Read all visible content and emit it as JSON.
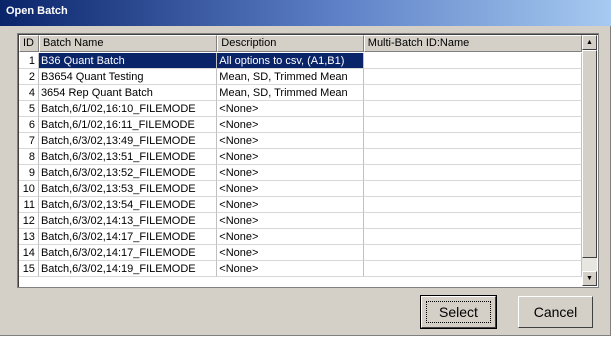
{
  "window": {
    "title": "Open Batch"
  },
  "columns": [
    "ID",
    "Batch Name",
    "Description",
    "Multi-Batch ID:Name"
  ],
  "rows": [
    {
      "id": "1",
      "name": "B36 Quant Batch",
      "description": "All options to csv, (A1,B1)",
      "multi": ""
    },
    {
      "id": "2",
      "name": "B3654 Quant Testing",
      "description": "Mean, SD, Trimmed Mean",
      "multi": ""
    },
    {
      "id": "4",
      "name": "3654 Rep Quant Batch",
      "description": "Mean, SD, Trimmed Mean",
      "multi": ""
    },
    {
      "id": "5",
      "name": "Batch,6/1/02,16:10_FILEMODE",
      "description": "<None>",
      "multi": ""
    },
    {
      "id": "6",
      "name": "Batch,6/1/02,16:11_FILEMODE",
      "description": "<None>",
      "multi": ""
    },
    {
      "id": "7",
      "name": "Batch,6/3/02,13:49_FILEMODE",
      "description": "<None>",
      "multi": ""
    },
    {
      "id": "8",
      "name": "Batch,6/3/02,13:51_FILEMODE",
      "description": "<None>",
      "multi": ""
    },
    {
      "id": "9",
      "name": "Batch,6/3/02,13:52_FILEMODE",
      "description": "<None>",
      "multi": ""
    },
    {
      "id": "10",
      "name": "Batch,6/3/02,13:53_FILEMODE",
      "description": "<None>",
      "multi": ""
    },
    {
      "id": "11",
      "name": "Batch,6/3/02,13:54_FILEMODE",
      "description": "<None>",
      "multi": ""
    },
    {
      "id": "12",
      "name": "Batch,6/3/02,14:13_FILEMODE",
      "description": "<None>",
      "multi": ""
    },
    {
      "id": "13",
      "name": "Batch,6/3/02,14:17_FILEMODE",
      "description": "<None>",
      "multi": ""
    },
    {
      "id": "14",
      "name": "Batch,6/3/02,14:17_FILEMODE",
      "description": "<None>",
      "multi": ""
    },
    {
      "id": "15",
      "name": "Batch,6/3/02,14:19_FILEMODE",
      "description": "<None>",
      "multi": ""
    }
  ],
  "selected_row_id": "1",
  "scrollbar": {
    "up_icon": "scroll-up-arrow-icon",
    "down_icon": "scroll-down-arrow-icon"
  },
  "buttons": {
    "select_label": "Select",
    "cancel_label": "Cancel"
  },
  "colors": {
    "title_bar": "#0a246a",
    "selection": "#0a246a",
    "face": "#d4d0c8"
  }
}
